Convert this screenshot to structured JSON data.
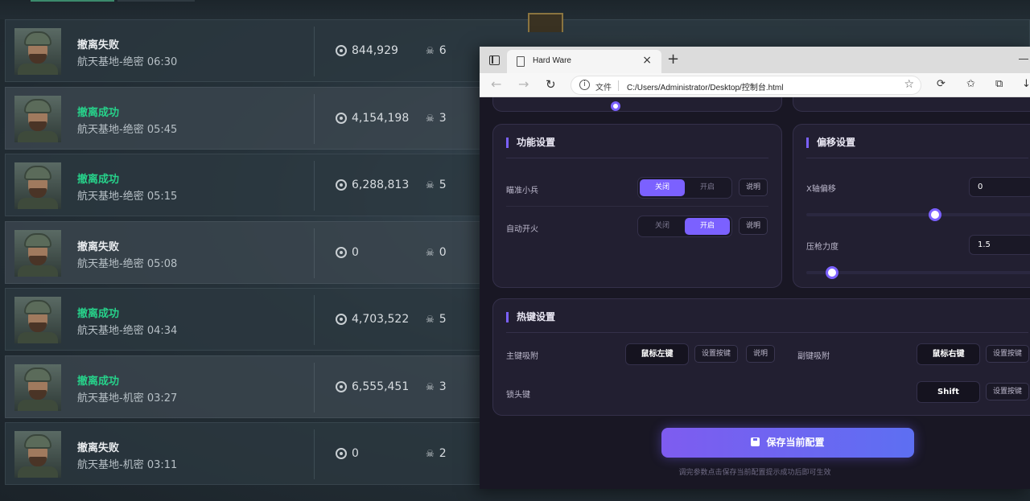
{
  "game_list": {
    "rows": [
      {
        "status": "撤离失败",
        "success": false,
        "map": "航天基地-绝密",
        "time": "06:30",
        "money": "844,929",
        "kills": "6"
      },
      {
        "status": "撤离成功",
        "success": true,
        "map": "航天基地-绝密",
        "time": "05:45",
        "money": "4,154,198",
        "kills": "3"
      },
      {
        "status": "撤离成功",
        "success": true,
        "map": "航天基地-绝密",
        "time": "05:15",
        "money": "6,288,813",
        "kills": "5"
      },
      {
        "status": "撤离失败",
        "success": false,
        "map": "航天基地-绝密",
        "time": "05:08",
        "money": "0",
        "kills": "0"
      },
      {
        "status": "撤离成功",
        "success": true,
        "map": "航天基地-绝密",
        "time": "04:34",
        "money": "4,703,522",
        "kills": "5"
      },
      {
        "status": "撤离成功",
        "success": true,
        "map": "航天基地-机密",
        "time": "03:27",
        "money": "6,555,451",
        "kills": "3"
      },
      {
        "status": "撤离失败",
        "success": false,
        "map": "航天基地-机密",
        "time": "03:11",
        "money": "0",
        "kills": "2"
      }
    ]
  },
  "browser": {
    "tab_title": "Hard Ware",
    "new_tab_symbol": "+",
    "close_symbol": "×",
    "address_scheme": "文件",
    "address_path": "C:/Users/Administrator/Desktop/控制台.html"
  },
  "function_settings": {
    "title": "功能设置",
    "rows": [
      {
        "label": "瞄准小兵",
        "off_label": "关闭",
        "on_label": "开启",
        "enabled": false,
        "help_label": "说明"
      },
      {
        "label": "自动开火",
        "off_label": "关闭",
        "on_label": "开启",
        "enabled": true,
        "help_label": "说明"
      }
    ]
  },
  "offset_settings": {
    "title": "偏移设置",
    "x_offset": {
      "label": "X轴偏移",
      "value": "0",
      "slider_fraction": 0.5
    },
    "recoil": {
      "label": "压枪力度",
      "value": "1.5",
      "slider_fraction": 0.1
    }
  },
  "hotkey_settings": {
    "title": "热键设置",
    "main_bind": {
      "label": "主键吸附",
      "key": "鼠标左键",
      "set_label": "设置按键",
      "help_label": "说明"
    },
    "sub_bind": {
      "label": "副键吸附",
      "key": "鼠标右键",
      "set_label": "设置按键"
    },
    "lock_head": {
      "label": "锁头键",
      "key": "Shift",
      "set_label": "设置按键"
    }
  },
  "save": {
    "label": "保存当前配置",
    "hint": "调完参数点击保存当前配置提示成功后即可生效"
  },
  "colors": {
    "accent": "#7b61ff",
    "success": "#27d18a",
    "panel_bg": "#221f31"
  }
}
